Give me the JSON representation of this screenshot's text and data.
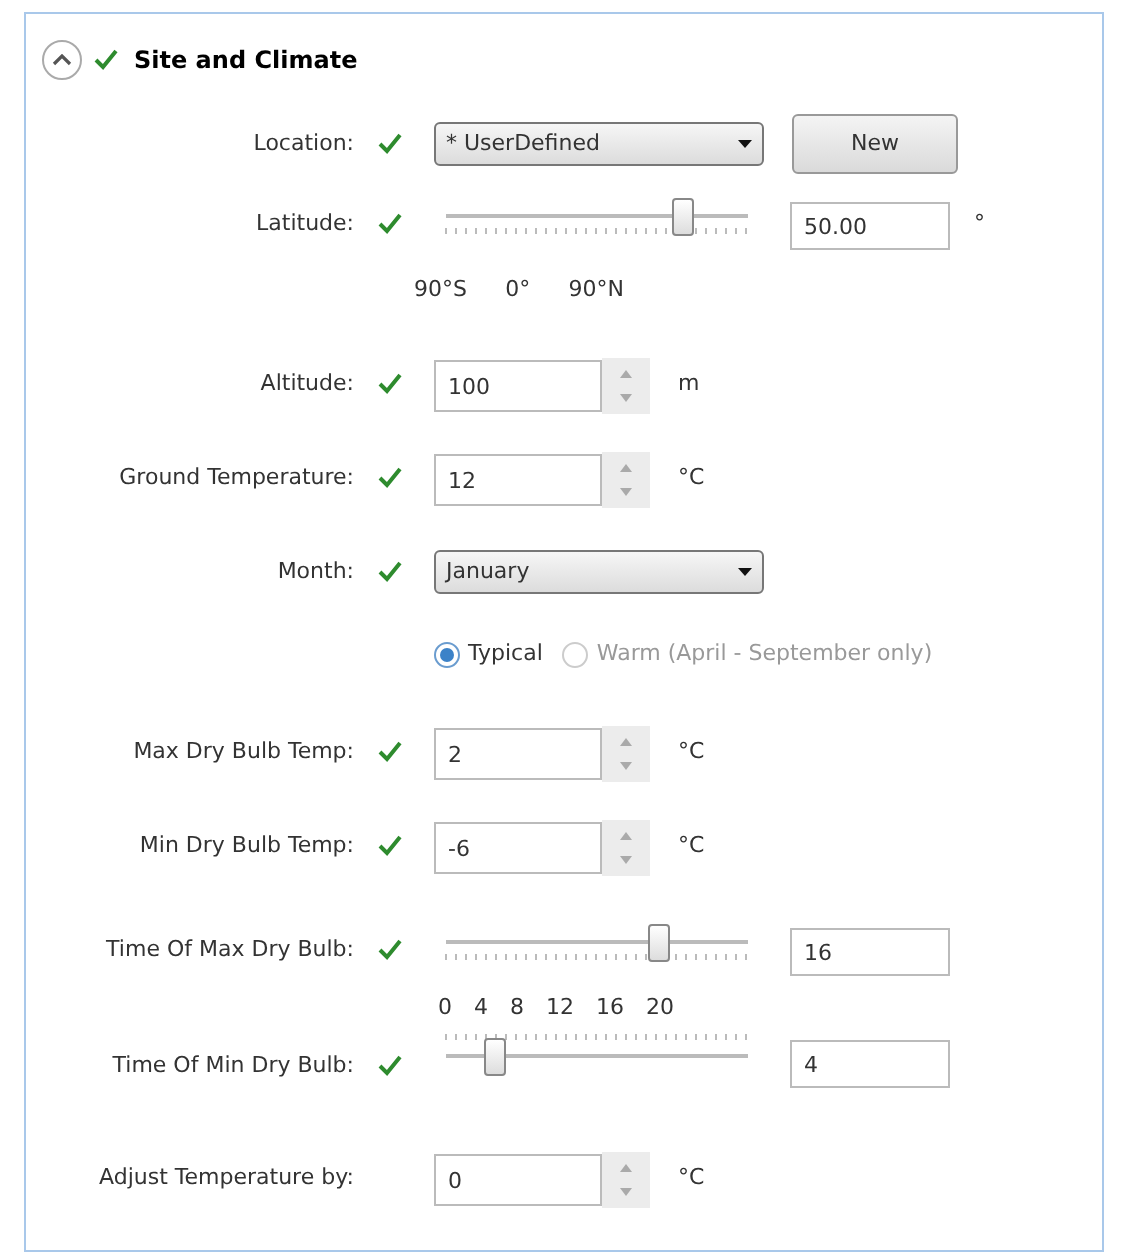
{
  "section": {
    "title": "Site and Climate",
    "expanded": true,
    "valid": true
  },
  "rows": [
    {
      "kind": "dropdown",
      "label": "Location:",
      "valid": true,
      "value": "* UserDefined",
      "button": "New"
    },
    {
      "kind": "slider",
      "label": "Latitude:",
      "valid": true,
      "level": 0.78,
      "value": "50.00",
      "unit": "°",
      "scale": [
        "90°S",
        "0°",
        "90°N"
      ]
    },
    {
      "kind": "spinner",
      "label": "Altitude:",
      "valid": true,
      "value": "100",
      "unit": "m"
    },
    {
      "kind": "spinner",
      "label": "Ground Temperature:",
      "valid": true,
      "value": "12",
      "unit": "°C"
    },
    {
      "kind": "dropdown",
      "label": "Month:",
      "valid": true,
      "value": "January"
    },
    {
      "kind": "radios",
      "options": [
        {
          "label": "Typical",
          "selected": true,
          "disabled": false
        },
        {
          "label": "Warm (April - September only)",
          "selected": false,
          "disabled": true
        }
      ]
    },
    {
      "kind": "spinner",
      "label": "Max Dry Bulb Temp:",
      "valid": true,
      "value": "2",
      "unit": "°C"
    },
    {
      "kind": "spinner",
      "label": "Min Dry Bulb Temp:",
      "valid": true,
      "value": "-6",
      "unit": "°C"
    },
    {
      "kind": "slider",
      "label": "Time Of Max Dry Bulb:",
      "valid": true,
      "level": 0.7,
      "value": "16",
      "scale": [
        "0",
        "4",
        "8",
        "12",
        "16",
        "20"
      ]
    },
    {
      "kind": "slider",
      "label": "Time Of Min Dry Bulb:",
      "valid": true,
      "level": 0.17,
      "value": "4"
    },
    {
      "kind": "spinner",
      "label": "Adjust Temperature by:",
      "valid": false,
      "value": "0",
      "unit": "°C"
    }
  ]
}
